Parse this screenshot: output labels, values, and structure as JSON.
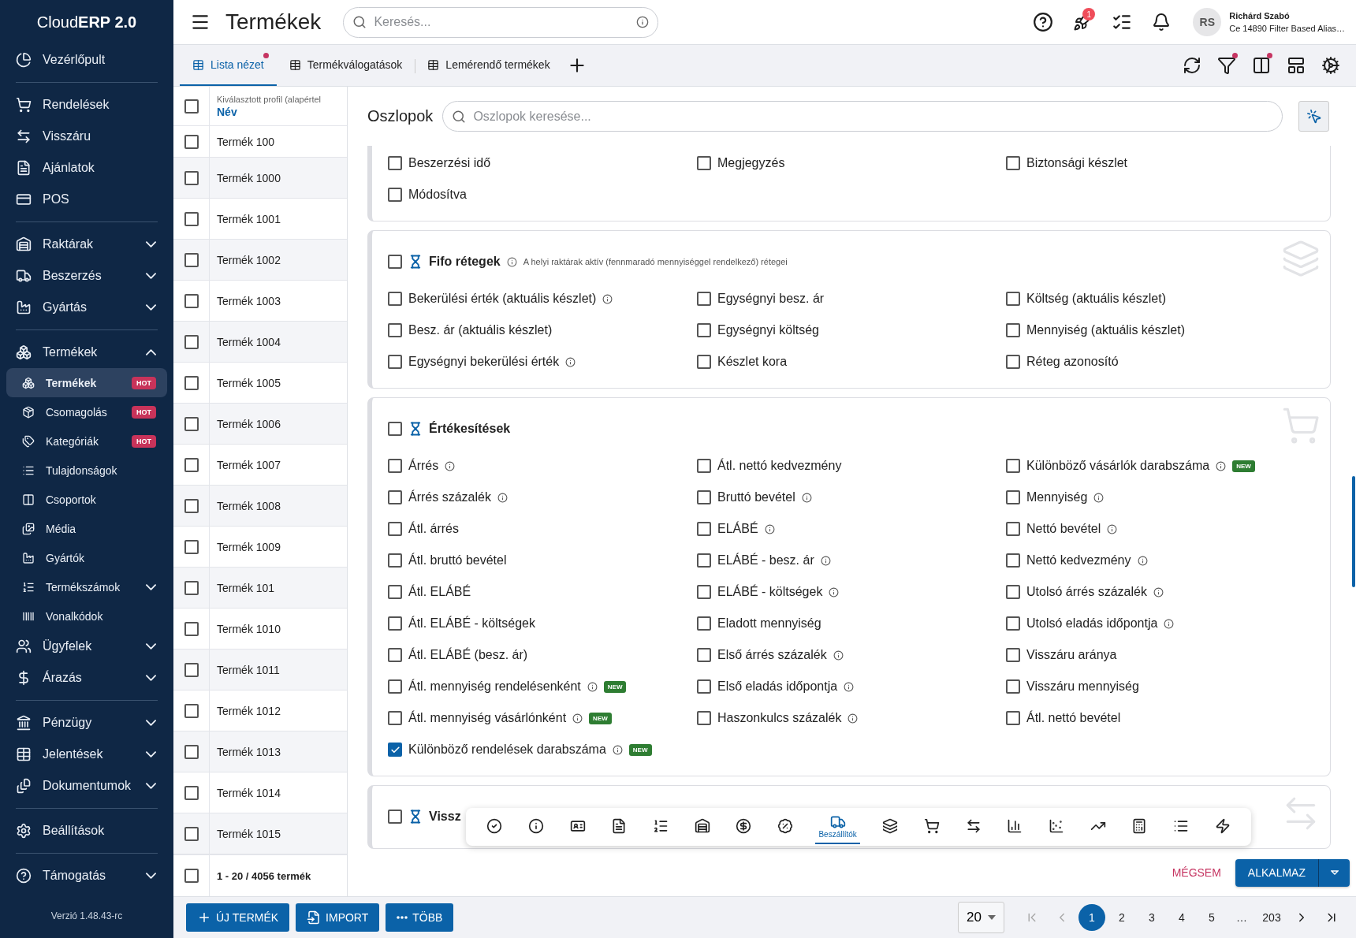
{
  "sidebar": {
    "brand": "Cloud**ERP 2.0**",
    "version": "Verzió 1.48.43-rc",
    "sections": [
      [
        {
          "label": "Vezérlőpult",
          "selected": false
        }
      ],
      [
        {
          "label": "Rendelések",
          "selected": false
        },
        {
          "label": "Visszáru",
          "selected": false
        },
        {
          "label": "Ajánlatok",
          "selected": false
        },
        {
          "label": "POS",
          "selected": false
        }
      ],
      [
        {
          "label": "Raktárak",
          "selected": false,
          "expanded": false
        },
        {
          "label": "Beszerzés",
          "selected": false,
          "expanded": false
        },
        {
          "label": "Gyártás",
          "selected": false,
          "expanded": false
        }
      ],
      [
        {
          "label": "Termékek",
          "selected": false,
          "expanded": true,
          "children": [
            {
              "label": "Termékek",
              "selected": true,
              "badge": "HOT"
            },
            {
              "label": "Csomagolás",
              "selected": false,
              "badge": "HOT"
            },
            {
              "label": "Kategóriák",
              "selected": false,
              "badge": "HOT"
            },
            {
              "label": "Tulajdonságok",
              "selected": false
            },
            {
              "label": "Csoportok",
              "selected": false
            },
            {
              "label": "Média",
              "selected": false
            },
            {
              "label": "Gyártók",
              "selected": false
            },
            {
              "label": "Termékszámok",
              "selected": false,
              "expanded": false
            },
            {
              "label": "Vonalkódok",
              "selected": false
            }
          ]
        },
        {
          "label": "Ügyfelek",
          "selected": false,
          "expanded": false
        },
        {
          "label": "Árazás",
          "selected": false,
          "expanded": false
        }
      ],
      [
        {
          "label": "Pénzügy",
          "selected": false,
          "expanded": false
        },
        {
          "label": "Jelentések",
          "selected": false,
          "expanded": false
        },
        {
          "label": "Dokumentumok",
          "selected": false,
          "expanded": false
        }
      ],
      [
        {
          "label": "Beállítások",
          "selected": false
        }
      ],
      [
        {
          "label": "Támogatás",
          "selected": false,
          "expanded": false
        }
      ]
    ]
  },
  "topbar": {
    "title": "Termékek",
    "search_placeholder": "Keresés...",
    "notification_count": "1",
    "user": {
      "initials": "RS",
      "name": "Richárd Szabó",
      "subtitle": "Ce 14890 Filter Based Alias…"
    }
  },
  "tabs": [
    {
      "label": "Lista nézet",
      "selected": true,
      "dot": true
    },
    {
      "label": "Termékválogatások",
      "selected": false,
      "dot": false
    },
    {
      "label": "Lemérendő termékek",
      "selected": false,
      "dot": false
    }
  ],
  "view_tools": [
    {
      "dot": false
    },
    {
      "dot": true
    },
    {
      "dot": true
    },
    {
      "dot": false
    },
    {
      "dot": false
    }
  ],
  "table": {
    "header_checked": false,
    "total_checked": false,
    "profile": "Kiválasztott profil (alapértel",
    "column": "Név",
    "total": "1 - 20 / 4056 termék",
    "rows": [
      {
        "name": "Termék 100",
        "checked": false
      },
      {
        "name": "Termék 1000",
        "checked": false
      },
      {
        "name": "Termék 1001",
        "checked": false
      },
      {
        "name": "Termék 1002",
        "checked": false
      },
      {
        "name": "Termék 1003",
        "checked": false
      },
      {
        "name": "Termék 1004",
        "checked": false
      },
      {
        "name": "Termék 1005",
        "checked": false
      },
      {
        "name": "Termék 1006",
        "checked": false
      },
      {
        "name": "Termék 1007",
        "checked": false
      },
      {
        "name": "Termék 1008",
        "checked": false
      },
      {
        "name": "Termék 1009",
        "checked": false
      },
      {
        "name": "Termék 101",
        "checked": false
      },
      {
        "name": "Termék 1010",
        "checked": false
      },
      {
        "name": "Termék 1011",
        "checked": false
      },
      {
        "name": "Termék 1012",
        "checked": false
      },
      {
        "name": "Termék 1013",
        "checked": false
      },
      {
        "name": "Termék 1014",
        "checked": false
      },
      {
        "name": "Termék 1015",
        "checked": false
      }
    ]
  },
  "columns_panel": {
    "title": "Oszlopok",
    "search_placeholder": "Oszlopok keresése...",
    "sections": [
      {
        "columns": [
          [
            {
              "label": "Beszerzési idő",
              "checked": false
            },
            {
              "label": "Módosítva",
              "checked": false
            }
          ],
          [
            {
              "label": "Megjegyzés",
              "checked": false
            }
          ],
          [
            {
              "label": "Biztonsági készlet",
              "checked": false
            }
          ]
        ]
      },
      {
        "title": "Fifo rétegek",
        "checked": false,
        "description": "A helyi raktárak aktív (fennmaradó mennyiséggel rendelkező) rétegei",
        "columns": [
          [
            {
              "label": "Bekerülési érték (aktuális készlet)",
              "checked": false,
              "info": true
            },
            {
              "label": "Besz. ár (aktuális készlet)",
              "checked": false
            },
            {
              "label": "Egységnyi bekerülési érték",
              "checked": false,
              "info": true
            }
          ],
          [
            {
              "label": "Egységnyi besz. ár",
              "checked": false
            },
            {
              "label": "Egységnyi költség",
              "checked": false
            },
            {
              "label": "Készlet kora",
              "checked": false
            }
          ],
          [
            {
              "label": "Költség (aktuális készlet)",
              "checked": false
            },
            {
              "label": "Mennyiség (aktuális készlet)",
              "checked": false
            },
            {
              "label": "Réteg azonosító",
              "checked": false
            }
          ]
        ]
      },
      {
        "title": "Értékesítések",
        "checked": false,
        "columns": [
          [
            {
              "label": "Árrés",
              "checked": false,
              "info": true
            },
            {
              "label": "Árrés százalék",
              "checked": false,
              "info": true
            },
            {
              "label": "Átl. árrés",
              "checked": false
            },
            {
              "label": "Átl. bruttó bevétel",
              "checked": false
            },
            {
              "label": "Átl. ELÁBÉ",
              "checked": false
            },
            {
              "label": "Átl. ELÁBÉ - költségek",
              "checked": false
            },
            {
              "label": "Átl. ELÁBÉ (besz. ár)",
              "checked": false
            },
            {
              "label": "Átl. mennyiség rendelésenként",
              "checked": false,
              "info": true,
              "badge": "NEW"
            },
            {
              "label": "Átl. mennyiség vásárlónként",
              "checked": false,
              "info": true,
              "badge": "NEW"
            },
            {
              "label": "Különböző rendelések darabszáma",
              "checked": true,
              "info": true,
              "badge": "NEW"
            }
          ],
          [
            {
              "label": "Átl. nettó kedvezmény",
              "checked": false
            },
            {
              "label": "Bruttó bevétel",
              "checked": false,
              "info": true
            },
            {
              "label": "ELÁBÉ",
              "checked": false,
              "info": true
            },
            {
              "label": "ELÁBÉ - besz. ár",
              "checked": false,
              "info": true
            },
            {
              "label": "ELÁBÉ - költségek",
              "checked": false,
              "info": true
            },
            {
              "label": "Eladott mennyiség",
              "checked": false
            },
            {
              "label": "Első árrés százalék",
              "checked": false,
              "info": true
            },
            {
              "label": "Első eladás időpontja",
              "checked": false,
              "info": true
            },
            {
              "label": "Haszonkulcs százalék",
              "checked": false,
              "info": true
            }
          ],
          [
            {
              "label": "Különböző vásárlók darabszáma",
              "checked": false,
              "info": true,
              "badge": "NEW"
            },
            {
              "label": "Mennyiség",
              "checked": false,
              "info": true
            },
            {
              "label": "Nettó bevétel",
              "checked": false,
              "info": true
            },
            {
              "label": "Nettó kedvezmény",
              "checked": false,
              "info": true
            },
            {
              "label": "Utolsó árrés százalék",
              "checked": false,
              "info": true
            },
            {
              "label": "Utolsó eladás időpontja",
              "checked": false,
              "info": true
            },
            {
              "label": "Visszáru aránya",
              "checked": false
            },
            {
              "label": "Visszáru mennyiség",
              "checked": false
            },
            {
              "label": "Átl. nettó bevétel",
              "checked": false
            }
          ]
        ]
      },
      {
        "title": "Vissz",
        "checked": false
      }
    ],
    "section_nav": [
      {
        "selected": false
      },
      {
        "selected": false
      },
      {
        "selected": false
      },
      {
        "selected": false
      },
      {
        "selected": false
      },
      {
        "selected": false
      },
      {
        "selected": false
      },
      {
        "selected": false
      },
      {
        "selected": true,
        "label": "Beszállítók"
      },
      {
        "selected": false
      },
      {
        "selected": false
      },
      {
        "selected": false
      },
      {
        "selected": false
      },
      {
        "selected": false
      },
      {
        "selected": false
      },
      {
        "selected": false
      },
      {
        "selected": false
      },
      {
        "selected": false
      }
    ],
    "cancel": "MÉGSEM",
    "apply": "ALKALMAZ"
  },
  "footer": {
    "buttons": [
      "ÚJ TERMÉK",
      "IMPORT",
      "TÖBB"
    ],
    "page_size": "20",
    "pages": [
      {
        "label": "1",
        "selected": true
      },
      {
        "label": "2",
        "selected": false
      },
      {
        "label": "3",
        "selected": false
      },
      {
        "label": "4",
        "selected": false
      },
      {
        "label": "5",
        "selected": false
      },
      {
        "label": "…",
        "selected": false
      },
      {
        "label": "203",
        "selected": false
      }
    ]
  }
}
